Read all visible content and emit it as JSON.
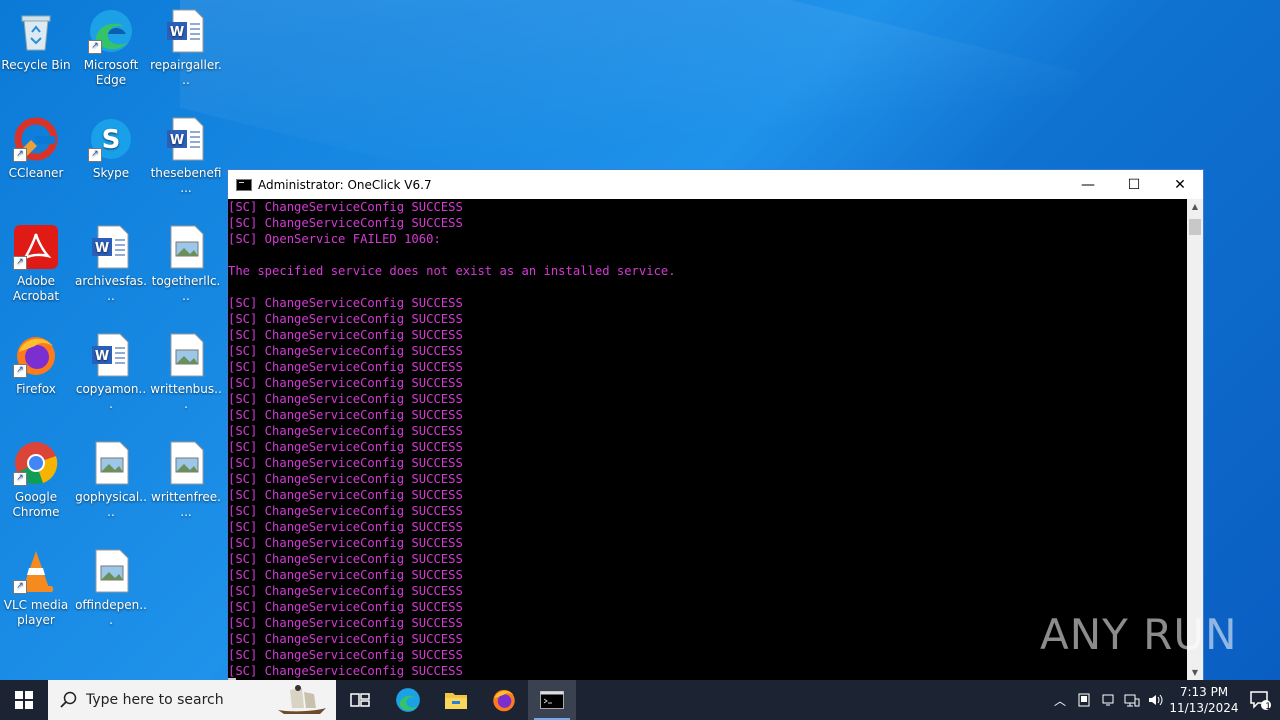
{
  "desktop": {
    "icons": [
      {
        "label": "Recycle Bin"
      },
      {
        "label": "Microsoft Edge"
      },
      {
        "label": "repairgaller..."
      },
      {
        "label": "CCleaner"
      },
      {
        "label": "Skype"
      },
      {
        "label": "thesebenefi..."
      },
      {
        "label": "Adobe Acrobat"
      },
      {
        "label": "archivesfas..."
      },
      {
        "label": "togetherllc..."
      },
      {
        "label": "Firefox"
      },
      {
        "label": "copyamon..."
      },
      {
        "label": "writtenbus..."
      },
      {
        "label": "Google Chrome"
      },
      {
        "label": "gophysical...."
      },
      {
        "label": "writtenfree...."
      },
      {
        "label": "VLC media player"
      },
      {
        "label": "offindepen..."
      }
    ]
  },
  "window": {
    "title": "Administrator:  OneClick V6.7",
    "minimize": "—",
    "maximize": "☐",
    "close": "✕",
    "console_lines": [
      "[SC] ChangeServiceConfig SUCCESS",
      "[SC] ChangeServiceConfig SUCCESS",
      "[SC] OpenService FAILED 1060:",
      "",
      "The specified service does not exist as an installed service.",
      "",
      "[SC] ChangeServiceConfig SUCCESS",
      "[SC] ChangeServiceConfig SUCCESS",
      "[SC] ChangeServiceConfig SUCCESS",
      "[SC] ChangeServiceConfig SUCCESS",
      "[SC] ChangeServiceConfig SUCCESS",
      "[SC] ChangeServiceConfig SUCCESS",
      "[SC] ChangeServiceConfig SUCCESS",
      "[SC] ChangeServiceConfig SUCCESS",
      "[SC] ChangeServiceConfig SUCCESS",
      "[SC] ChangeServiceConfig SUCCESS",
      "[SC] ChangeServiceConfig SUCCESS",
      "[SC] ChangeServiceConfig SUCCESS",
      "[SC] ChangeServiceConfig SUCCESS",
      "[SC] ChangeServiceConfig SUCCESS",
      "[SC] ChangeServiceConfig SUCCESS",
      "[SC] ChangeServiceConfig SUCCESS",
      "[SC] ChangeServiceConfig SUCCESS",
      "[SC] ChangeServiceConfig SUCCESS",
      "[SC] ChangeServiceConfig SUCCESS",
      "[SC] ChangeServiceConfig SUCCESS",
      "[SC] ChangeServiceConfig SUCCESS",
      "[SC] ChangeServiceConfig SUCCESS",
      "[SC] ChangeServiceConfig SUCCESS",
      "[SC] ChangeServiceConfig SUCCESS"
    ],
    "console_color": "#d43bd4"
  },
  "watermark": "ANY RUN",
  "taskbar": {
    "search_placeholder": "Type here to search",
    "time": "7:13 PM",
    "date": "11/13/2024",
    "notification_count": "1"
  }
}
